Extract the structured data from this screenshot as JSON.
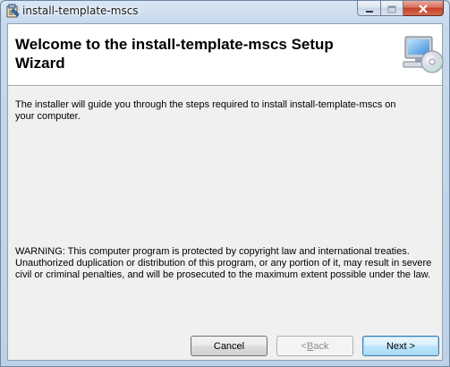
{
  "window": {
    "title": "install-template-mscs",
    "icons": {
      "app": "installer-package-icon",
      "minimize": "minimize-icon",
      "maximize": "maximize-icon",
      "close": "close-icon"
    }
  },
  "banner": {
    "title": "Welcome to the install-template-mscs Setup Wizard",
    "icon": "computer-cd-icon"
  },
  "body": {
    "intro": "The installer will guide you through the steps required to install install-template-mscs on your computer.",
    "warning": "WARNING: This computer program is protected by copyright law and international treaties. Unauthorized duplication or distribution of this program, or any portion of it, may result in severe civil or criminal penalties, and will be prosecuted to the maximum extent possible under the law."
  },
  "buttons": {
    "cancel": "Cancel",
    "back_mnemonic": "B",
    "back_rest": "ack",
    "back_prefix": "< ",
    "next": "Next >"
  },
  "colors": {
    "title_bar": "#c7d8ec",
    "client_bg": "#f0f0f0",
    "banner_bg": "#ffffff",
    "close_button": "#c3412b",
    "default_button_border": "#3c7fb1"
  }
}
